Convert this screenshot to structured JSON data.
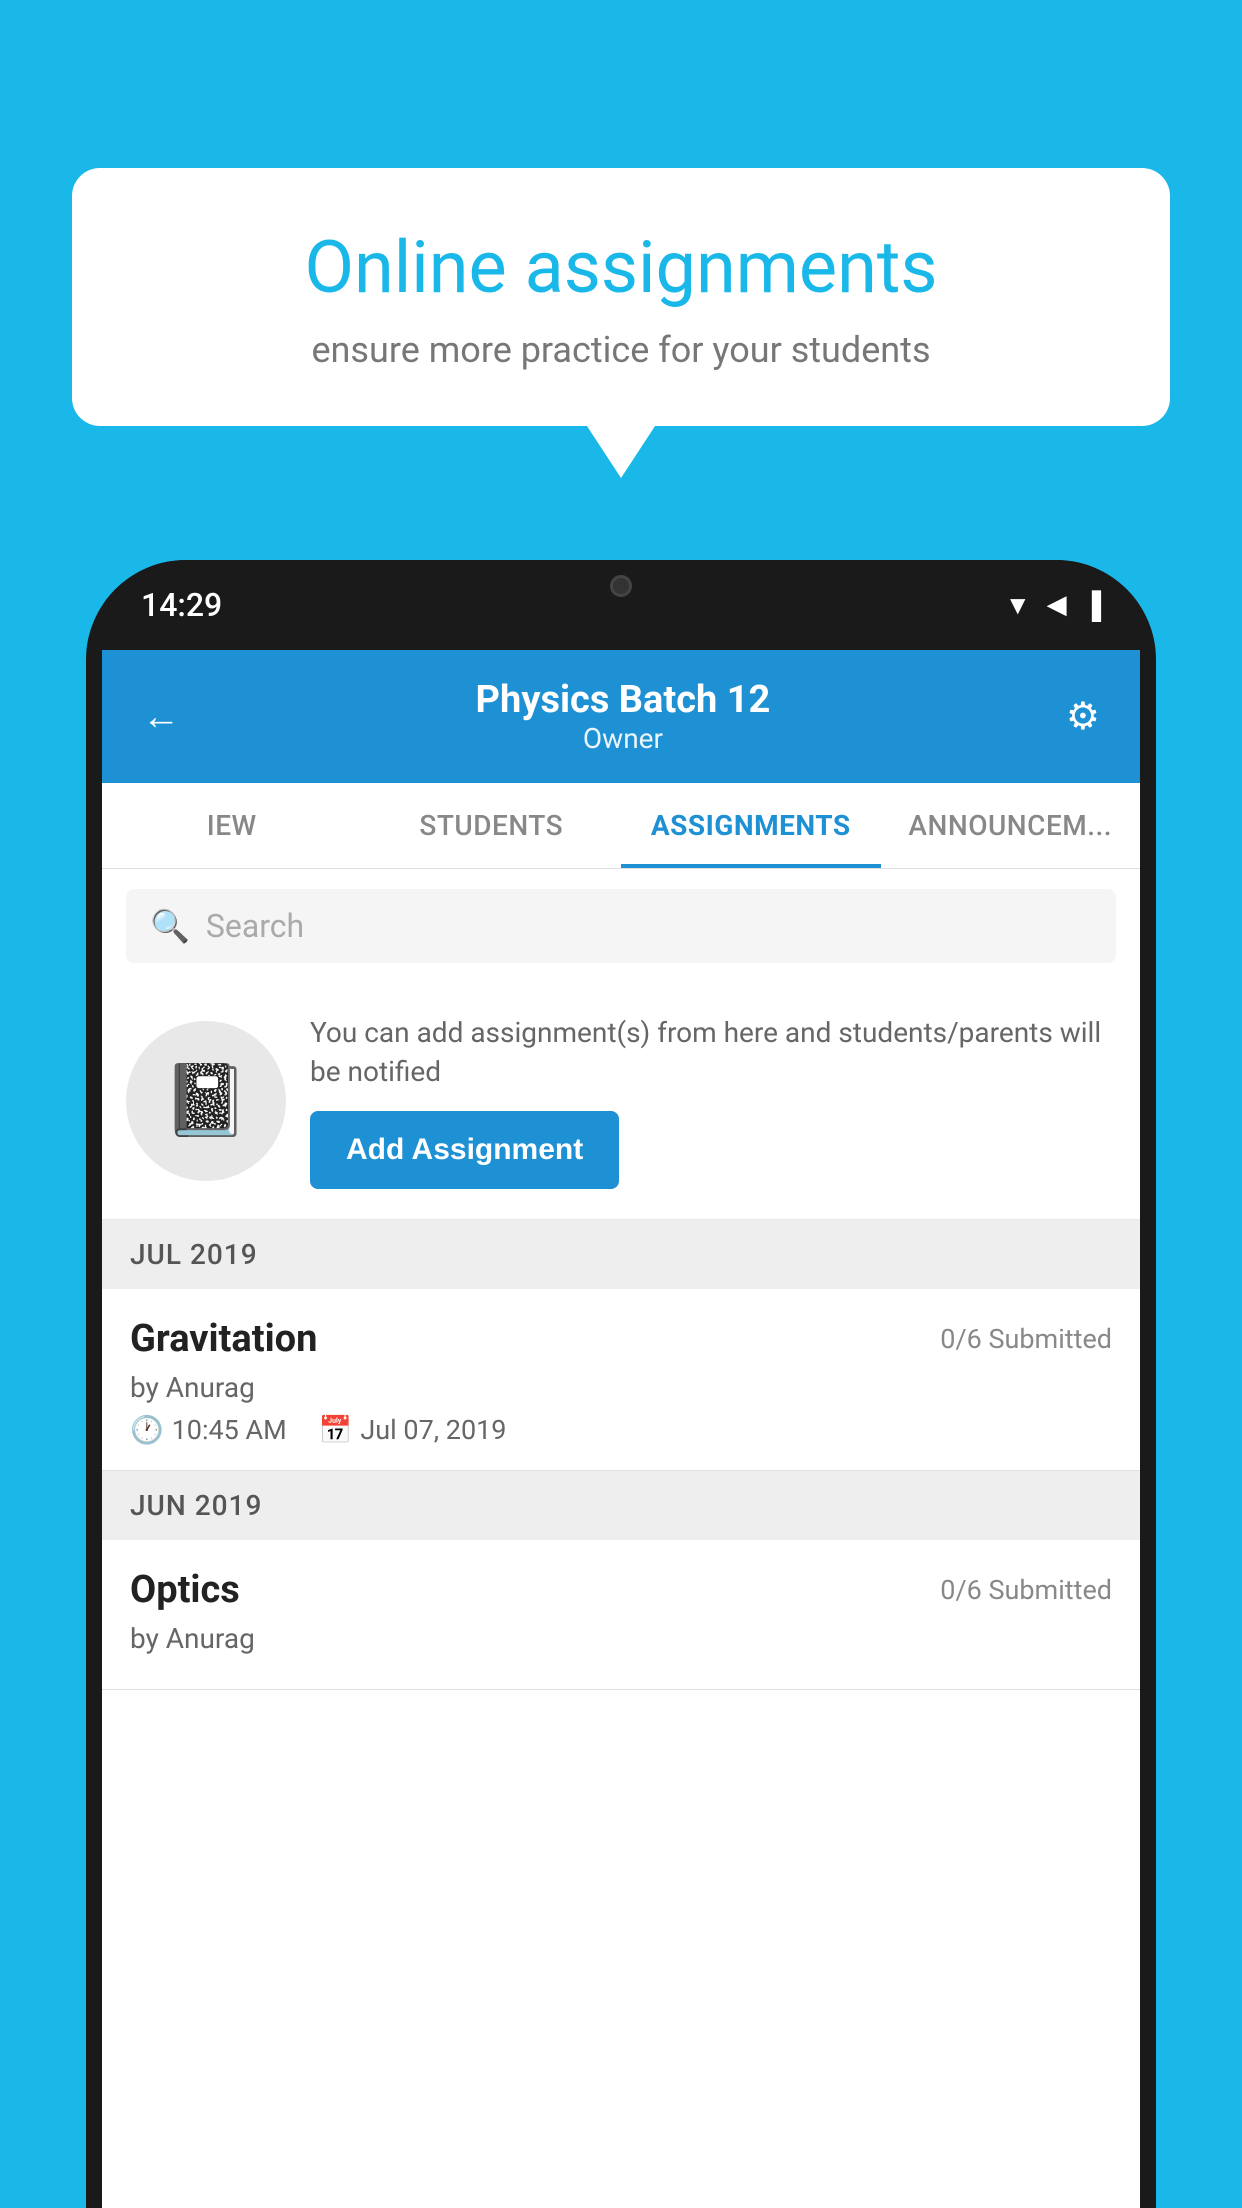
{
  "background_color": "#1ab8e8",
  "speech_bubble": {
    "title": "Online assignments",
    "subtitle": "ensure more practice for your students"
  },
  "phone": {
    "status_bar": {
      "time": "14:29"
    },
    "header": {
      "title": "Physics Batch 12",
      "subtitle": "Owner",
      "back_label": "←",
      "settings_label": "⚙"
    },
    "tabs": [
      {
        "label": "IEW",
        "active": false
      },
      {
        "label": "STUDENTS",
        "active": false
      },
      {
        "label": "ASSIGNMENTS",
        "active": true
      },
      {
        "label": "ANNOUNCEM...",
        "active": false
      }
    ],
    "search": {
      "placeholder": "Search"
    },
    "promo": {
      "text": "You can add assignment(s) from here and students/parents will be notified",
      "button_label": "Add Assignment"
    },
    "sections": [
      {
        "month": "JUL 2019",
        "assignments": [
          {
            "name": "Gravitation",
            "submitted": "0/6 Submitted",
            "by": "by Anurag",
            "time": "10:45 AM",
            "date": "Jul 07, 2019"
          }
        ]
      },
      {
        "month": "JUN 2019",
        "assignments": [
          {
            "name": "Optics",
            "submitted": "0/6 Submitted",
            "by": "by Anurag",
            "time": "",
            "date": ""
          }
        ]
      }
    ]
  }
}
